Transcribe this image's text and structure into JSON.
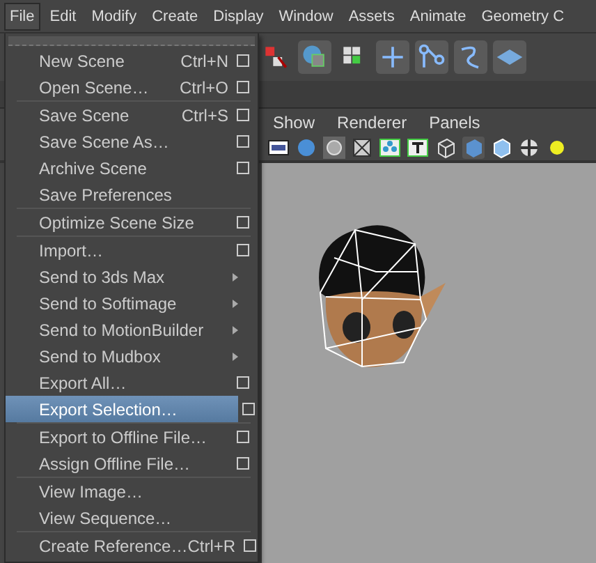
{
  "menubar": [
    {
      "label": "File",
      "selected": true
    },
    {
      "label": "Edit",
      "selected": false
    },
    {
      "label": "Modify",
      "selected": false
    },
    {
      "label": "Create",
      "selected": false
    },
    {
      "label": "Display",
      "selected": false
    },
    {
      "label": "Window",
      "selected": false
    },
    {
      "label": "Assets",
      "selected": false
    },
    {
      "label": "Animate",
      "selected": false
    },
    {
      "label": "Geometry C",
      "selected": false
    }
  ],
  "file_menu": {
    "sections": [
      [
        {
          "label": "New Scene",
          "shortcut": "Ctrl+N",
          "kind": "option",
          "selected": false
        },
        {
          "label": "Open Scene…",
          "shortcut": "Ctrl+O",
          "kind": "option",
          "selected": false
        }
      ],
      [
        {
          "label": "Save Scene",
          "shortcut": "Ctrl+S",
          "kind": "option",
          "selected": false
        },
        {
          "label": "Save Scene As…",
          "kind": "option",
          "selected": false
        },
        {
          "label": "Archive Scene",
          "kind": "option",
          "selected": false
        },
        {
          "label": "Save Preferences",
          "kind": "plain",
          "selected": false
        }
      ],
      [
        {
          "label": "Optimize Scene Size",
          "kind": "option",
          "selected": false
        }
      ],
      [
        {
          "label": "Import…",
          "kind": "option",
          "selected": false
        },
        {
          "label": "Send to 3ds Max",
          "kind": "submenu",
          "selected": false
        },
        {
          "label": "Send to Softimage",
          "kind": "submenu",
          "selected": false
        },
        {
          "label": "Send to MotionBuilder",
          "kind": "submenu",
          "selected": false
        },
        {
          "label": "Send to Mudbox",
          "kind": "submenu",
          "selected": false
        },
        {
          "label": "Export All…",
          "kind": "option",
          "selected": false
        },
        {
          "label": "Export Selection…",
          "kind": "option",
          "selected": true
        }
      ],
      [
        {
          "label": "Export to Offline File…",
          "kind": "option",
          "selected": false
        },
        {
          "label": "Assign Offline File…",
          "kind": "option",
          "selected": false
        }
      ],
      [
        {
          "label": "View Image…",
          "kind": "plain",
          "selected": false
        },
        {
          "label": "View Sequence…",
          "kind": "plain",
          "selected": false
        }
      ],
      [
        {
          "label": "Create Reference…",
          "shortcut": "Ctrl+R",
          "kind": "option",
          "selected": false
        }
      ]
    ]
  },
  "panel_menu": [
    "Show",
    "Renderer",
    "Panels"
  ]
}
